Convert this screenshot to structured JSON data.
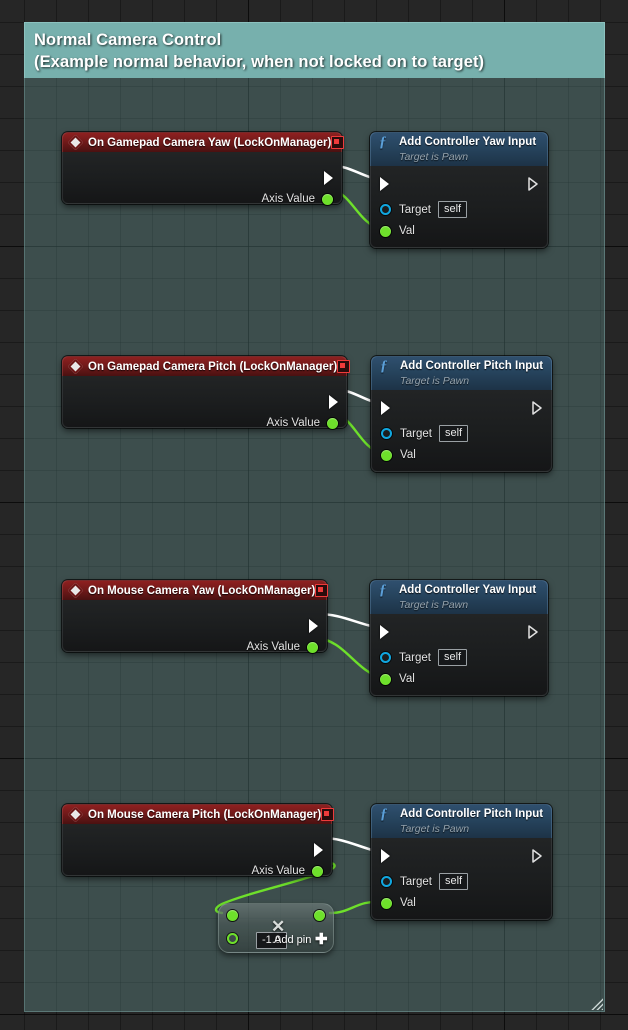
{
  "comment": {
    "line1": "Normal Camera Control",
    "line2": "(Example normal behavior, when not locked on to target)",
    "header_color": "#77b0ad",
    "body_color": "rgba(116,172,170,0.30)"
  },
  "nodes": {
    "event_gamepad_yaw": {
      "title": "On Gamepad Camera Yaw  (LockOnManager)",
      "output_pins": {
        "exec": "",
        "axis_value": "Axis Value"
      }
    },
    "fn_yaw_1": {
      "title": "Add Controller Yaw Input",
      "subtitle": "Target is Pawn",
      "pins": {
        "target": "Target",
        "target_value": "self",
        "val": "Val"
      }
    },
    "event_gamepad_pitch": {
      "title": "On Gamepad Camera Pitch (LockOnManager)",
      "output_pins": {
        "exec": "",
        "axis_value": "Axis Value"
      }
    },
    "fn_pitch_1": {
      "title": "Add Controller Pitch Input",
      "subtitle": "Target is Pawn",
      "pins": {
        "target": "Target",
        "target_value": "self",
        "val": "Val"
      }
    },
    "event_mouse_yaw": {
      "title": "On Mouse Camera Yaw (LockOnManager)",
      "output_pins": {
        "exec": "",
        "axis_value": "Axis Value"
      }
    },
    "fn_yaw_2": {
      "title": "Add Controller Yaw Input",
      "subtitle": "Target is Pawn",
      "pins": {
        "target": "Target",
        "target_value": "self",
        "val": "Val"
      }
    },
    "event_mouse_pitch": {
      "title": "On Mouse Camera Pitch (LockOnManager)",
      "output_pins": {
        "exec": "",
        "axis_value": "Axis Value"
      }
    },
    "fn_pitch_2": {
      "title": "Add Controller Pitch Input",
      "subtitle": "Target is Pawn",
      "pins": {
        "target": "Target",
        "target_value": "self",
        "val": "Val"
      }
    },
    "multiply": {
      "symbol": "✕",
      "add_pin_label": "Add pin",
      "add_pin_plus": "✚",
      "operand_value": "-1.0"
    }
  },
  "colors": {
    "event_header": "#7a1c1c",
    "function_header": "#27455f",
    "exec_wire": "#ffffff",
    "data_wire": "#6ee02b",
    "object_pin": "#10a7e0",
    "float_pin": "#6ee02b"
  }
}
